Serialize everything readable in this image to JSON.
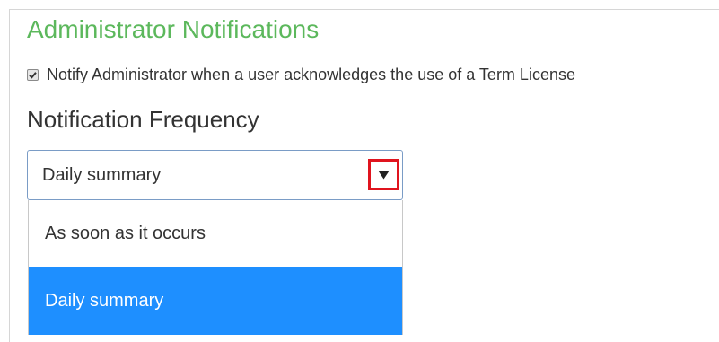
{
  "admin_notifications": {
    "title": "Administrator Notifications",
    "notify_checkbox": {
      "checked": true,
      "label": "Notify Administrator when a user acknowledges the use of a Term License"
    }
  },
  "notification_frequency": {
    "title": "Notification Frequency",
    "select": {
      "selected_value": "Daily summary",
      "dropdown_icon": "triangle-down-icon",
      "highlight_color": "#e0141e",
      "options": [
        {
          "label": "As soon as it occurs",
          "selected": false
        },
        {
          "label": "Daily summary",
          "selected": true
        }
      ],
      "selected_option_color": "#1e8fff"
    }
  },
  "colors": {
    "section_title": "#5cb85c",
    "text": "#333333"
  }
}
